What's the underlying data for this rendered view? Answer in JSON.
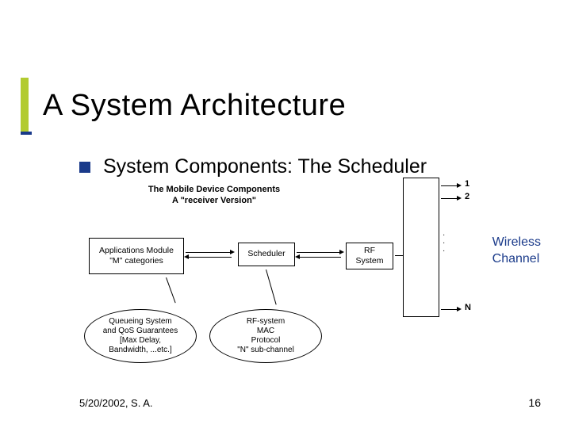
{
  "title": "A System Architecture",
  "subtitle": "System Components: The Scheduler",
  "diagram": {
    "top_label_line1": "The Mobile Device Components",
    "top_label_line2": "A \"receiver Version\"",
    "apps_box_line1": "Applications Module",
    "apps_box_line2": "\"M\" categories",
    "scheduler_box": "Scheduler",
    "rf_box_line1": "RF",
    "rf_box_line2": "System",
    "callout1_l1": "Queueing System",
    "callout1_l2": "and QoS Guarantees",
    "callout1_l3": "[Max Delay,",
    "callout1_l4": "Bandwidth, ...etc.]",
    "callout2_l1": "RF-system",
    "callout2_l2": "MAC",
    "callout2_l3": "Protocol",
    "callout2_l4": "\"N\" sub-channel",
    "num1": "1",
    "num2": "2",
    "numN": "N"
  },
  "wireless_l1": "Wireless",
  "wireless_l2": "Channel",
  "footer_date": "5/20/2002, S. A.",
  "page_num": "16"
}
